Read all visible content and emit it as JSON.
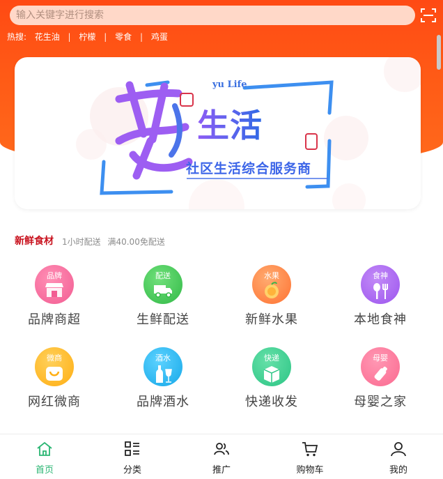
{
  "search": {
    "placeholder": "输入关键字进行搜索"
  },
  "hot_search": {
    "label": "热搜:",
    "keywords": [
      "花生油",
      "柠檬",
      "零食",
      "鸡蛋"
    ]
  },
  "banner": {
    "english": "yu Life",
    "title": "生活",
    "subtitle": "社区生活综合服务商"
  },
  "section": {
    "title": "新鲜食材",
    "delivery": "1小时配送",
    "free_shipping": "满40.00免配送"
  },
  "categories": [
    {
      "tag": "品牌",
      "label": "品牌商超",
      "icon": "storefront-icon",
      "color": "#f25c92"
    },
    {
      "tag": "配送",
      "label": "生鲜配送",
      "icon": "delivery-truck-icon",
      "color": "#3cc551"
    },
    {
      "tag": "水果",
      "label": "新鲜水果",
      "icon": "fruit-icon",
      "color": "#ff7d3a"
    },
    {
      "tag": "食神",
      "label": "本地食神",
      "icon": "food-icon",
      "color": "#a35ef0"
    },
    {
      "tag": "微商",
      "label": "网红微商",
      "icon": "shopping-bag-icon",
      "color": "#ffb71c"
    },
    {
      "tag": "酒水",
      "label": "品牌酒水",
      "icon": "wine-bottle-icon",
      "color": "#1fb4ee"
    },
    {
      "tag": "快递",
      "label": "快递收发",
      "icon": "package-icon",
      "color": "#36c98c"
    },
    {
      "tag": "母婴",
      "label": "母婴之家",
      "icon": "baby-bottle-icon",
      "color": "#fd6e94"
    }
  ],
  "tabbar": [
    {
      "label": "首页",
      "icon": "home-icon",
      "active": true
    },
    {
      "label": "分类",
      "icon": "category-icon",
      "active": false
    },
    {
      "label": "推广",
      "icon": "users-icon",
      "active": false
    },
    {
      "label": "购物车",
      "icon": "cart-icon",
      "active": false
    },
    {
      "label": "我的",
      "icon": "user-icon",
      "active": false
    }
  ],
  "colors": {
    "header": "#ff5316",
    "accent": "#c8101c",
    "active_tab": "#2bb673"
  }
}
